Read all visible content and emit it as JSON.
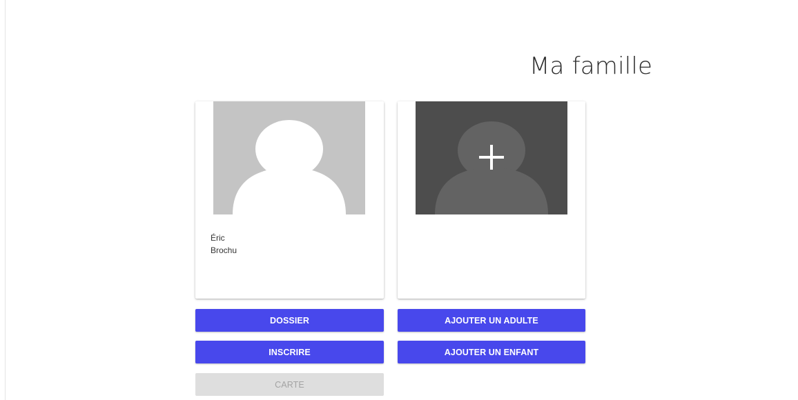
{
  "page": {
    "title": "Ma famille"
  },
  "members": [
    {
      "first_name": "Éric",
      "last_name": "Brochu",
      "avatar_icon": "person-placeholder-icon"
    }
  ],
  "add_member": {
    "icon": "add-person-icon"
  },
  "buttons": {
    "dossier": "DOSSIER",
    "inscrire": "INSCRIRE",
    "carte": "CARTE",
    "add_adult": "AJOUTER UN ADULTE",
    "add_child": "AJOUTER UN ENFANT"
  },
  "colors": {
    "primary": "#4848ec",
    "disabled_bg": "#dedede",
    "disabled_text": "#a3a3a3",
    "avatar_placeholder": "#c4c4c4",
    "add_avatar_bg": "#4d4d4d"
  }
}
